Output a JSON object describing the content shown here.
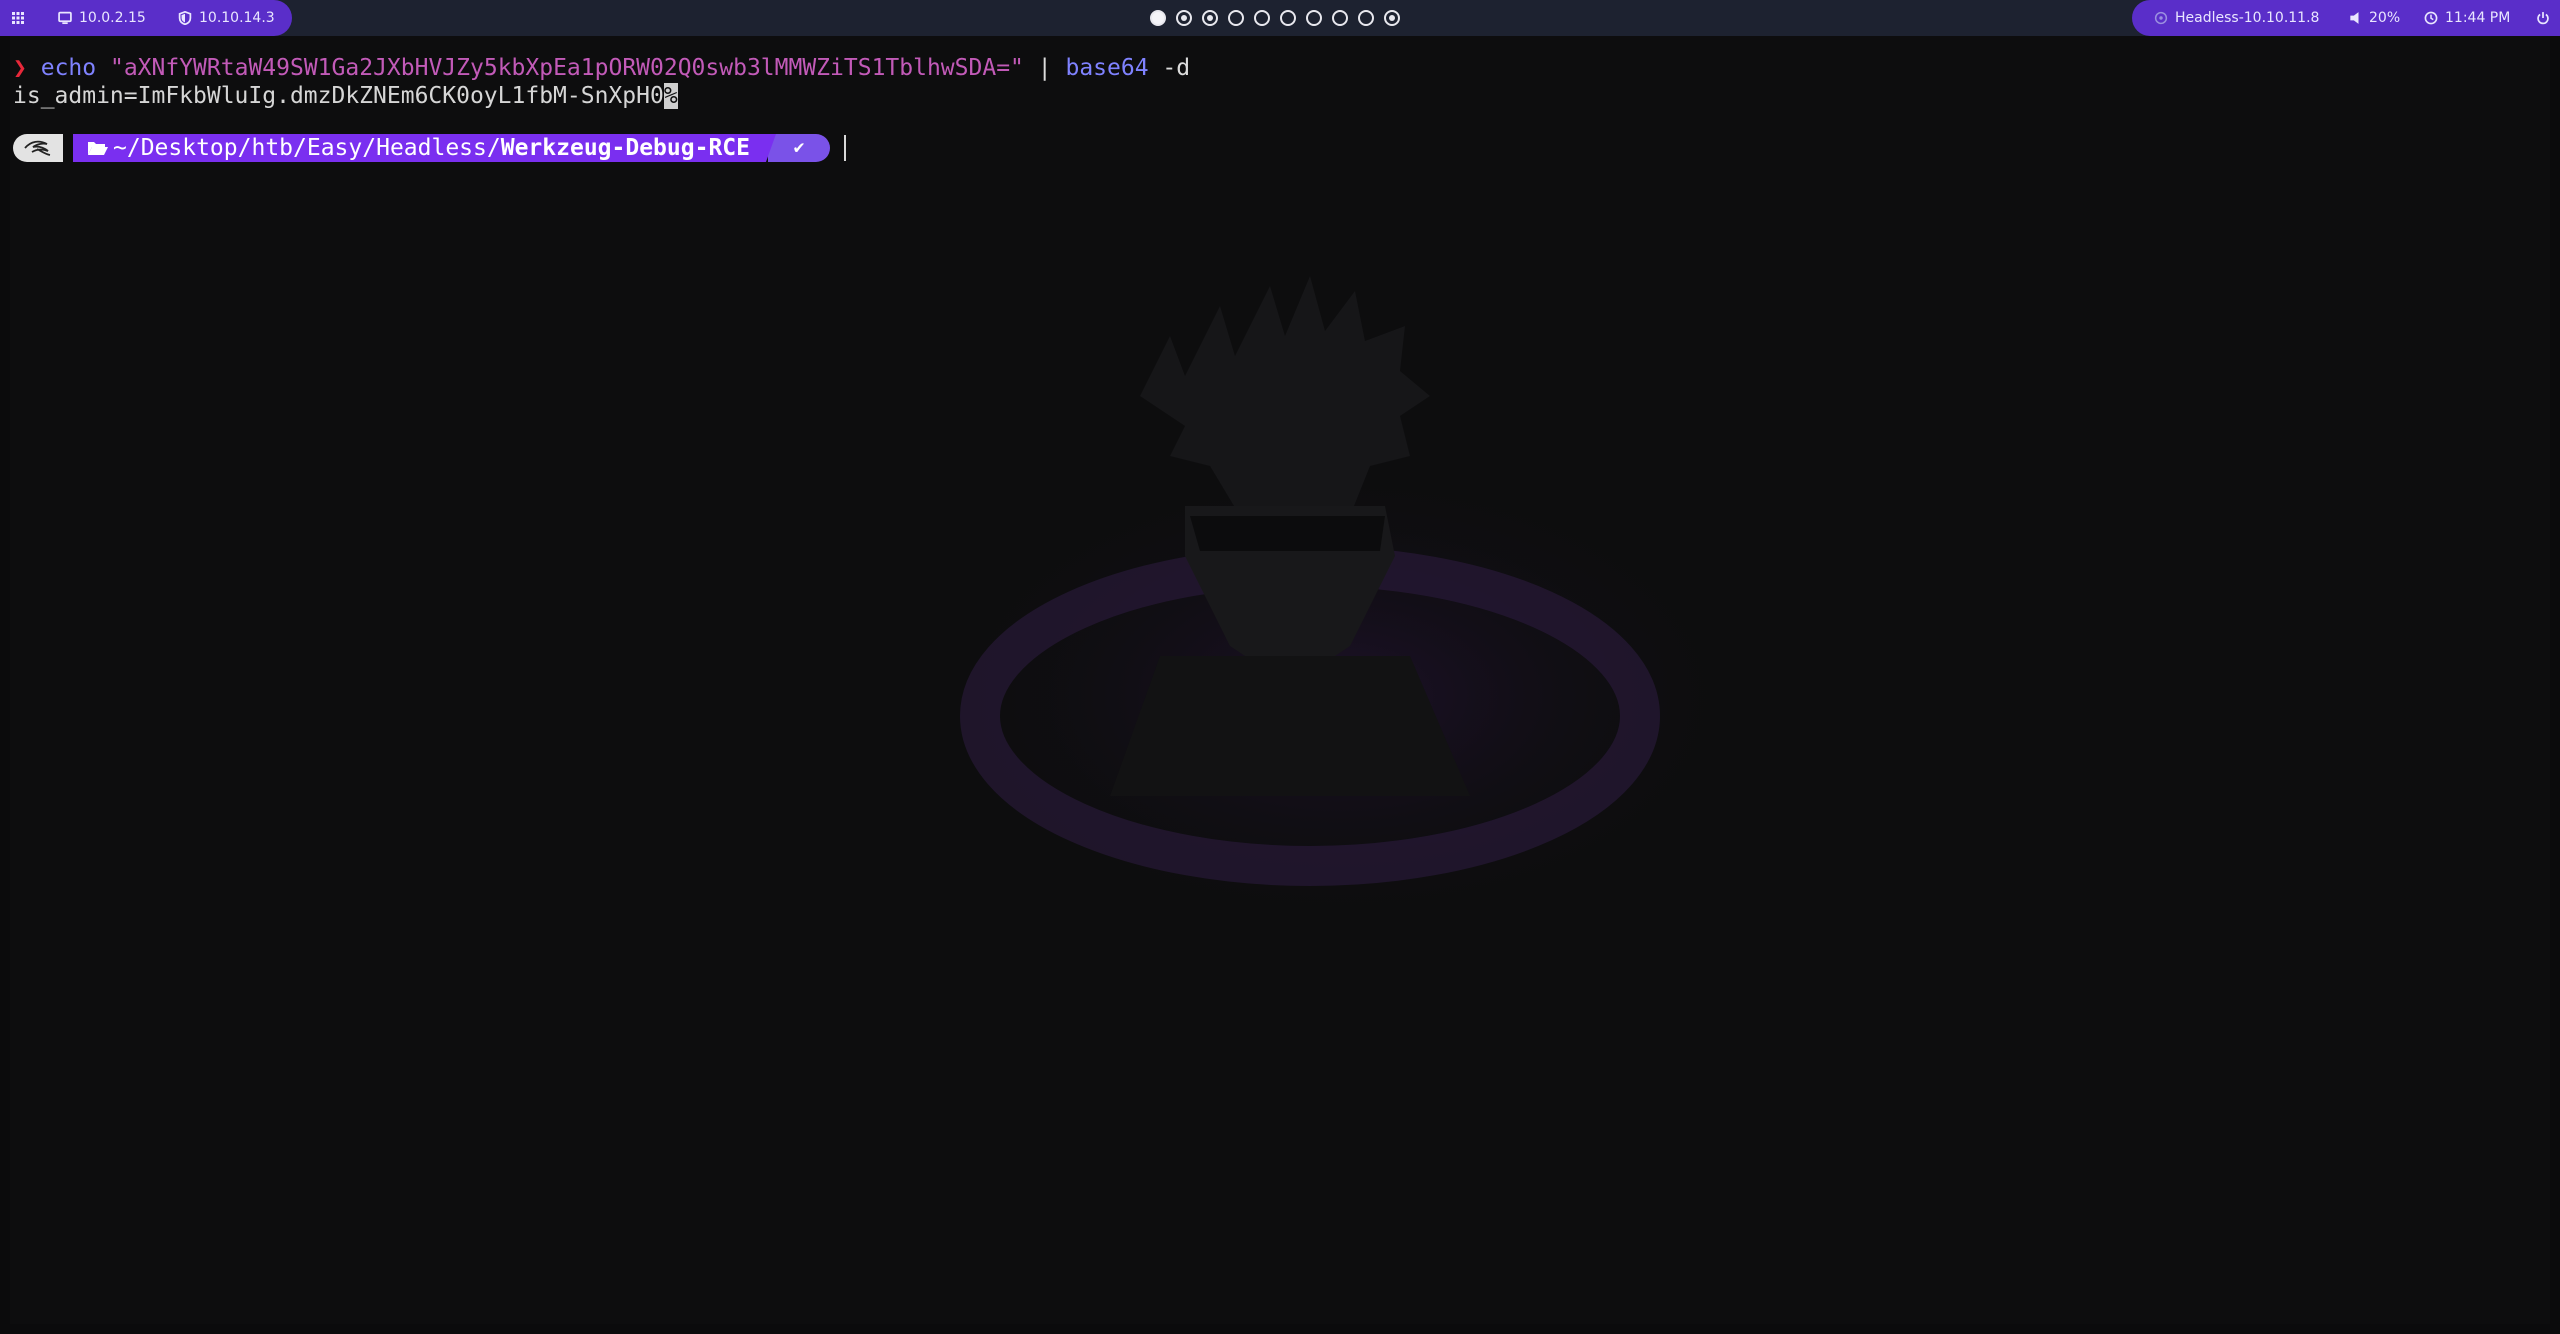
{
  "topbar": {
    "left": {
      "menu_icon": "grid-icon",
      "ip_eth": "10.0.2.15",
      "ip_vpn": "10.10.14.3"
    },
    "workspaces": [
      "active",
      "occupied",
      "occupied",
      "empty",
      "empty",
      "empty",
      "empty",
      "empty",
      "empty",
      "occupied"
    ],
    "right": {
      "target": "Headless-10.10.11.8",
      "volume": "20%",
      "time": "11:44 PM",
      "power_icon": "power-icon"
    }
  },
  "terminal": {
    "prompt_symbol": "❯",
    "command": "echo",
    "argument": "\"aXNfYWRtaW49SW1Ga2JXbHVJZy5kbXpEa1pORW02Q0swb3lMMWZiTS1TblhwSDA=\"",
    "pipe": "|",
    "pipe_command": "base64",
    "pipe_flag": "-d",
    "output": "is_admin=ImFkbWluIg.dmzDkZNEm6CK0oyL1fbM-SnXpH0",
    "output_cursor": "%",
    "prompt": {
      "os_icon": "kali-dragon-icon",
      "folder_icon": "folder-open-icon",
      "path_prefix": "~/Desktop/htb/Easy/Headless/",
      "path_current": "Werkzeug-Debug-RCE",
      "status": "✔"
    }
  }
}
